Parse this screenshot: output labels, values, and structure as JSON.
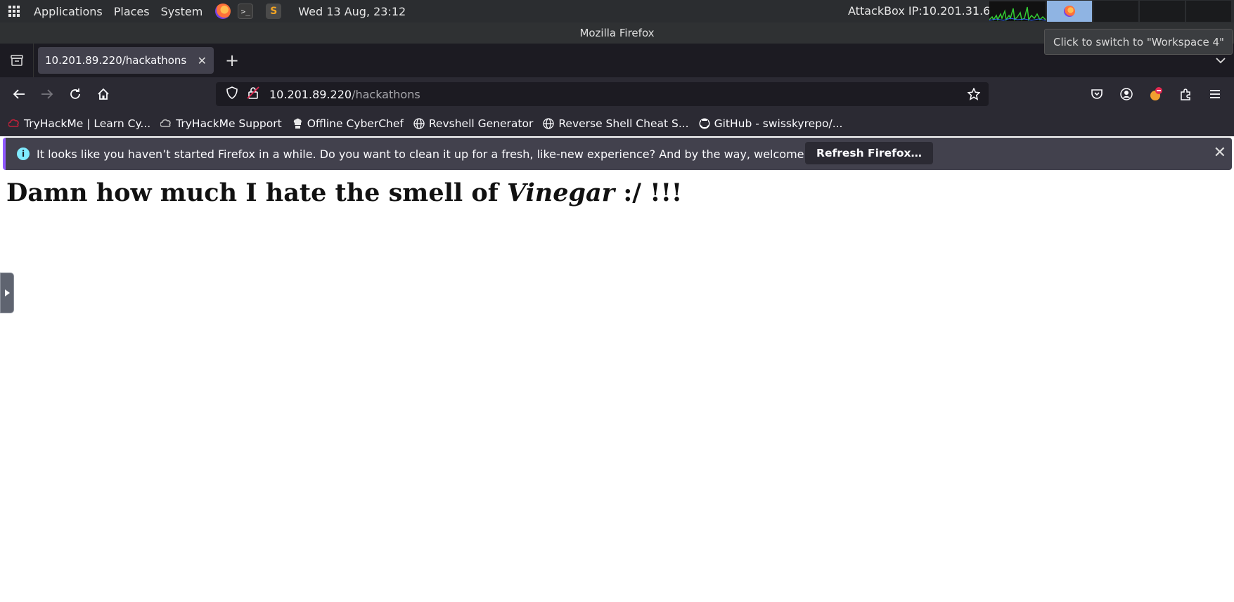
{
  "panel": {
    "menus": [
      "Applications",
      "Places",
      "System"
    ],
    "clock": "Wed 13 Aug, 23:12",
    "attackbox_ip": "AttackBox IP:10.201.31.69",
    "launchers": [
      "firefox-icon",
      "terminal-icon",
      "sublime-text-icon"
    ]
  },
  "window": {
    "title": "Mozilla Firefox"
  },
  "tooltip": {
    "text": "Click to switch to \"Workspace 4\""
  },
  "tabs": [
    {
      "label": "10.201.89.220/hackathons",
      "active": true
    }
  ],
  "urlbar": {
    "host": "10.201.89.220",
    "path": "/hackathons"
  },
  "bookmarks": [
    {
      "label": "TryHackMe | Learn Cy...",
      "icon": "tryhackme-icon"
    },
    {
      "label": "TryHackMe Support",
      "icon": "cloud-icon"
    },
    {
      "label": "Offline CyberChef",
      "icon": "chef-icon"
    },
    {
      "label": "Revshell Generator",
      "icon": "globe-icon"
    },
    {
      "label": "Reverse Shell Cheat S...",
      "icon": "globe-icon"
    },
    {
      "label": "GitHub - swisskyrepo/...",
      "icon": "github-icon"
    }
  ],
  "notification": {
    "message": "It looks like you haven’t started Firefox in a while. Do you want to clean it up for a fresh, like-new experience? And by the way, welcome back!",
    "button": "Refresh Firefox…"
  },
  "page": {
    "heading_prefix": "Damn how much I hate the smell of",
    "heading_emphasis": "Vinegar",
    "heading_suffix": ":/ !!!"
  },
  "colors": {
    "panel_bg": "#2b2d30",
    "tab_active": "#42414d",
    "accent": "#9059ff"
  }
}
